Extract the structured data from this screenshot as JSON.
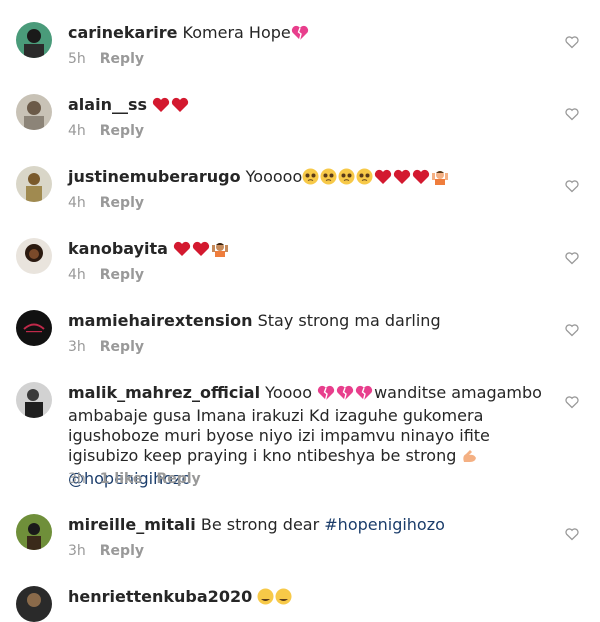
{
  "comments": [
    {
      "username": "carinekarire",
      "text": "Komera Hope",
      "emoji": [
        "broken-heart"
      ],
      "time": "5h",
      "reply": "Reply"
    },
    {
      "username": "alain__ss",
      "text": "",
      "emoji": [
        "heart",
        "heart"
      ],
      "time": "4h",
      "reply": "Reply"
    },
    {
      "username": "justinemuberarugo",
      "text": "Yooooo",
      "emoji": [
        "pleading-face",
        "pleading-face",
        "pleading-face",
        "pleading-face",
        "heart",
        "heart",
        "heart",
        "person-raising-hands"
      ],
      "time": "4h",
      "reply": "Reply"
    },
    {
      "username": "kanobayita",
      "text": "",
      "emoji": [
        "heart",
        "heart",
        "person-raising-hands"
      ],
      "time": "4h",
      "reply": "Reply"
    },
    {
      "username": "mamiehairextension",
      "text": "Stay strong ma darling",
      "emoji": [],
      "time": "3h",
      "reply": "Reply"
    },
    {
      "username": "malik_mahrez_official",
      "text_prefix": "Yoooo",
      "emoji_mid": [
        "broken-heart",
        "broken-heart",
        "broken-heart"
      ],
      "text": "wanditse amagambo ambabaje gusa Imana irakuzi Kd izaguhe gukomera igushoboze muri byose niyo izi impamvu ninayo ifite igisubizo keep praying i kno ntibeshya be strong",
      "emoji_end": [
        "flexed-biceps"
      ],
      "mention": "@hopenigihozo",
      "time": "3h",
      "likes": "1 like",
      "reply": "Reply"
    },
    {
      "username": "mireille_mitali",
      "text": "Be strong dear",
      "hashtag": "#hopenigihozo",
      "time": "3h",
      "reply": "Reply"
    },
    {
      "username": "henriettenkuba2020",
      "emoji": [
        "tears-of-joy",
        "tears-of-joy"
      ]
    }
  ],
  "icons": {
    "like": "heart-outline-icon"
  },
  "colors": {
    "text": "#262626",
    "meta": "#999999",
    "link": "#1b3d6b",
    "heart": "#d3192f",
    "broken_heart": "#e83e8c"
  }
}
